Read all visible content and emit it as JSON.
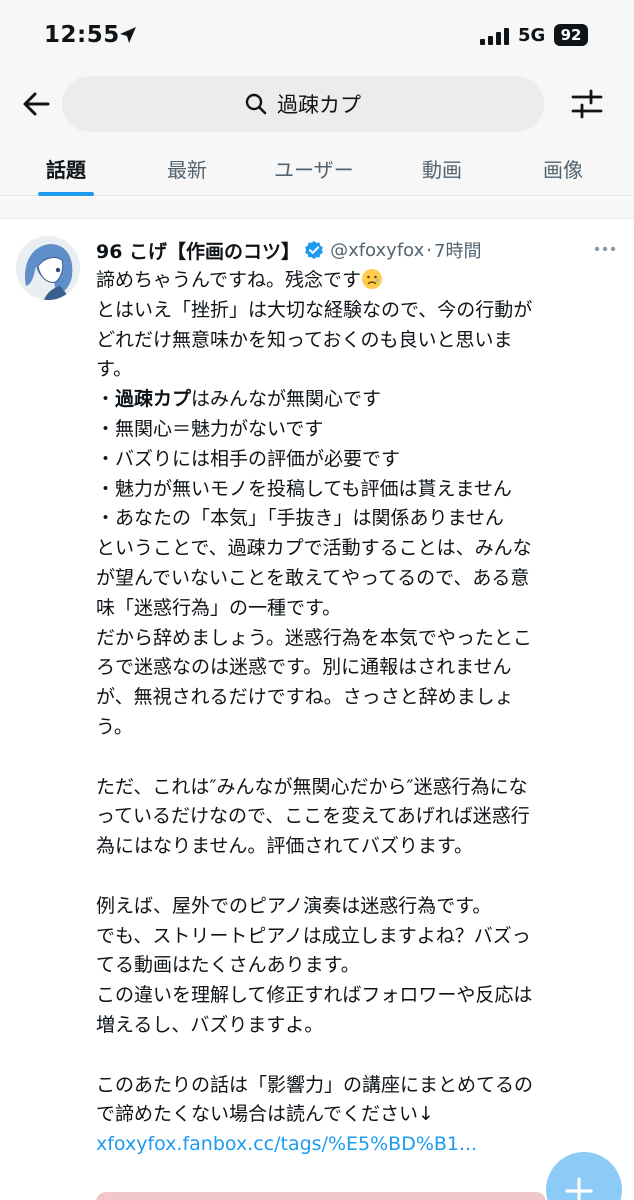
{
  "status_bar": {
    "time": "12:55",
    "network": "5G",
    "battery": "92"
  },
  "search": {
    "query": "過疎カプ"
  },
  "tabs": [
    {
      "label": "話題",
      "active": true
    },
    {
      "label": "最新",
      "active": false
    },
    {
      "label": "ユーザー",
      "active": false
    },
    {
      "label": "動画",
      "active": false
    },
    {
      "label": "画像",
      "active": false
    }
  ],
  "tweet": {
    "author_name": "96 こげ【作画のコツ】",
    "handle": "@xfoxyfox",
    "separator": "·",
    "time": "7時間",
    "lines": [
      {
        "text": "諦めちゃうんですね。残念です",
        "emoji": "sad-face-emoji"
      },
      {
        "text": "とはいえ「挫折」は大切な経験なので、今の行動が"
      },
      {
        "text": "どれだけ無意味かを知っておくのも良いと思いま"
      },
      {
        "text": "す。"
      },
      {
        "prefix": "・",
        "bold": "過疎カプ",
        "text": "はみんなが無関心です"
      },
      {
        "text": "・無関心＝魅力がないです"
      },
      {
        "text": "・バズりには相手の評価が必要です"
      },
      {
        "text": "・魅力が無いモノを投稿しても評価は貰えません"
      },
      {
        "text": "・あなたの「本気」「手抜き」は関係ありません"
      },
      {
        "text": "ということで、過疎カプで活動することは、みんな"
      },
      {
        "text": "が望んでいないことを敢えてやってるので、ある意"
      },
      {
        "text": "味「迷惑行為」の一種です。"
      },
      {
        "text": "だから辞めましょう。迷惑行為を本気でやったとこ"
      },
      {
        "text": "ろで迷惑なのは迷惑です。別に通報はされません"
      },
      {
        "text": "が、無視されるだけですね。さっさと辞めましょ"
      },
      {
        "text": "う。"
      },
      {
        "blank": true
      },
      {
        "text": "ただ、これは″みんなが無関心だから″迷惑行為にな"
      },
      {
        "text": "っているだけなので、ここを変えてあげれば迷惑行"
      },
      {
        "text": "為にはなりません。評価されてバズります。"
      },
      {
        "blank": true
      },
      {
        "text": "例えば、屋外でのピアノ演奏は迷惑行為です。"
      },
      {
        "text": "でも、ストリートピアノは成立しますよね？バズっ"
      },
      {
        "text": "てる動画はたくさんあります。"
      },
      {
        "text": "この違いを理解して修正すればフォロワーや反応は"
      },
      {
        "text": "増えるし、バズりますよ。"
      },
      {
        "blank": true
      },
      {
        "text": "このあたりの話は「影響力」の講座にまとめてるの"
      },
      {
        "text": "で諦めたくない場合は読んでください↓"
      },
      {
        "link": "xfoxyfox.fanbox.cc/tags/%E5%BD%B1..."
      }
    ]
  },
  "icons": [
    "location-arrow-icon",
    "back-arrow-icon",
    "search-icon",
    "filter-icon",
    "verified-badge-icon",
    "more-icon",
    "plus-icon"
  ],
  "colors": {
    "accent": "#1d9bf0",
    "text": "#0f1419",
    "muted": "#536471",
    "bar_bg": "#f7f7f7"
  }
}
